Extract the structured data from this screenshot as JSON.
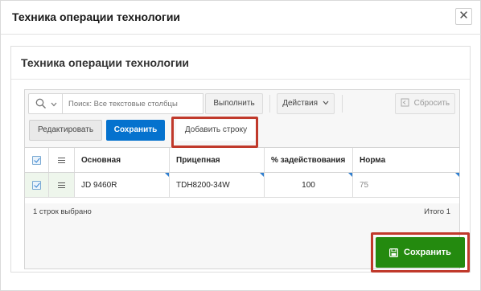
{
  "dialog": {
    "title": "Техника операции технологии",
    "close_glyph": "✕"
  },
  "region": {
    "title": "Техника операции технологии"
  },
  "toolbar": {
    "search_placeholder": "Поиск: Все текстовые столбцы",
    "execute_label": "Выполнить",
    "actions_label": "Действия",
    "reset_label": "Сбросить",
    "edit_label": "Редактировать",
    "save_label": "Сохранить",
    "add_row_label": "Добавить строку"
  },
  "grid": {
    "columns": [
      "Основная",
      "Прицепная",
      "% задействования",
      "Норма"
    ],
    "rows": [
      {
        "main": "JD 9460R",
        "trailer": "TDH8200-34W",
        "percent": "100",
        "norm": "75"
      }
    ],
    "selected_text": "1 строк выбрано",
    "total_text": "Итого 1"
  },
  "footer": {
    "save_label": "Сохранить"
  },
  "colors": {
    "primary_blue": "#0572ce",
    "success_green": "#248a0f",
    "highlight_red": "#c0392b"
  }
}
